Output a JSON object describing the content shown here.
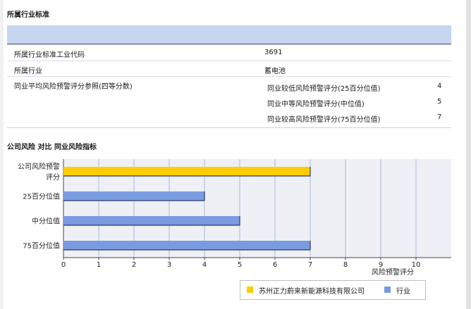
{
  "section1": {
    "title": "所属行业标准"
  },
  "table": {
    "rows": [
      {
        "key": "所属行业标准工业代码",
        "value": "3691"
      },
      {
        "key": "所属行业",
        "value": "蓄电池"
      },
      {
        "key": "同业平均风险预警评分参照(四等分数)",
        "value": ""
      }
    ],
    "sub_rows": [
      {
        "label": "同业较低风险预警评分(25百分位值)",
        "value": "4"
      },
      {
        "label": "同业中等风险预警评分(中位值)",
        "value": "5"
      },
      {
        "label": "同业较高风险预警评分(75百分位值)",
        "value": "7"
      }
    ]
  },
  "section2": {
    "title": "公司风险 对比 同业风险指标"
  },
  "colors": {
    "company": "#ffcc00",
    "industry": "#7b9be0",
    "grid": "#a9b8dc",
    "plot_bg": "#eef0f6",
    "header_bg": "#c6d5f0"
  },
  "chart_data": {
    "type": "bar",
    "orientation": "horizontal",
    "categories": [
      "公司风险预警评分",
      "25百分位值",
      "中分位值",
      "75百分位值"
    ],
    "category_display": [
      [
        "公司风险预警",
        "评分"
      ],
      [
        "25百分位值"
      ],
      [
        "中分位值"
      ],
      [
        "75百分位值"
      ]
    ],
    "series": [
      {
        "name": "苏州正力蔚来新能源科技有限公司",
        "color": "#ffcc00",
        "values": [
          7,
          null,
          null,
          null
        ]
      },
      {
        "name": "行业",
        "color": "#7b9be0",
        "values": [
          null,
          4,
          5,
          7
        ]
      }
    ],
    "xlabel": "风险预警评分",
    "xlim": [
      0,
      11
    ],
    "xticks": [
      0,
      1,
      2,
      3,
      4,
      5,
      6,
      7,
      8,
      9,
      10
    ],
    "grid": true,
    "legend_position": "bottom-right"
  }
}
